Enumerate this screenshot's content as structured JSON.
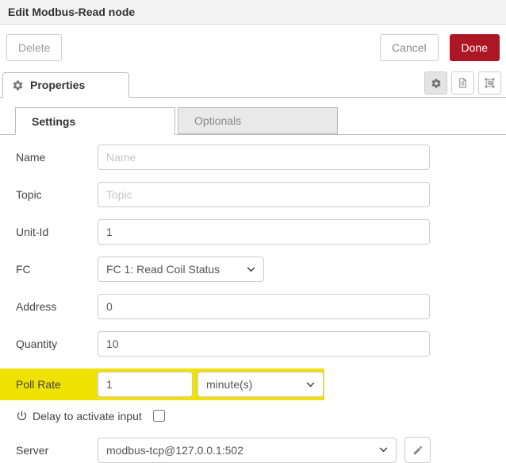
{
  "header": {
    "title": "Edit Modbus-Read node"
  },
  "toolbar": {
    "delete": "Delete",
    "cancel": "Cancel",
    "done": "Done"
  },
  "properties_tab": {
    "label": "Properties",
    "icon": "gear-icon"
  },
  "editor_icon_buttons": [
    {
      "name": "properties",
      "icon": "gear-icon",
      "active": true
    },
    {
      "name": "description",
      "icon": "document-icon",
      "active": false
    },
    {
      "name": "appearance",
      "icon": "appearance-frame-icon",
      "active": false
    }
  ],
  "tabs": [
    {
      "label": "Settings",
      "active": true
    },
    {
      "label": "Optionals",
      "active": false
    }
  ],
  "form": {
    "name": {
      "label": "Name",
      "placeholder": "Name",
      "value": ""
    },
    "topic": {
      "label": "Topic",
      "placeholder": "Topic",
      "value": ""
    },
    "unit_id": {
      "label": "Unit-Id",
      "value": "1"
    },
    "fc": {
      "label": "FC",
      "value": "FC 1: Read Coil Status"
    },
    "address": {
      "label": "Address",
      "value": "0"
    },
    "quantity": {
      "label": "Quantity",
      "value": "10"
    },
    "poll_rate": {
      "label": "Poll Rate",
      "value": "1",
      "unit": "minute(s)"
    },
    "delay": {
      "label": "Delay to activate input",
      "checked": false,
      "icon": "power-icon"
    },
    "server": {
      "label": "Server",
      "value": "modbus-tcp@127.0.0.1:502",
      "edit_icon": "pencil-icon"
    }
  },
  "colors": {
    "done_button": "#AD1625",
    "poll_rate_highlight": "#EFE202",
    "header_background": "#F3F3F3"
  }
}
